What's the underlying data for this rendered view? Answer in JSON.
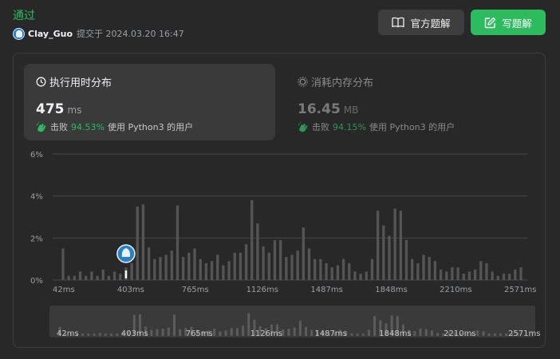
{
  "submission": {
    "status": "通过",
    "username": "Clay_Guo",
    "submitted_text": "提交于 2024.03.20 16:47"
  },
  "buttons": {
    "official_solution": "官方题解",
    "write_solution": "写题解"
  },
  "runtime": {
    "title": "执行用时分布",
    "value": "475",
    "unit": "ms",
    "beats_label": "击败",
    "beats_pct": "94.53%",
    "beats_suffix": "使用 Python3 的用户"
  },
  "memory": {
    "title": "消耗内存分布",
    "value": "16.45",
    "unit": "MB",
    "beats_label": "击败",
    "beats_pct": "94.15%",
    "beats_suffix": "使用 Python3 的用户"
  },
  "colors": {
    "accent_green": "#2cbb5d",
    "bar": "#555555",
    "bar_mini": "#5c5c5c",
    "grid": "#474747"
  },
  "chart_data": {
    "type": "bar",
    "ylabel": "",
    "xlabel": "",
    "ylim": [
      0,
      6
    ],
    "yticks": [
      "0%",
      "2%",
      "4%",
      "6%"
    ],
    "xticks": [
      "42ms",
      "403ms",
      "765ms",
      "1126ms",
      "1487ms",
      "1848ms",
      "2210ms",
      "2571ms"
    ],
    "grid": true,
    "marker_label": "user runtime position",
    "values": [
      1.5,
      0.2,
      0.2,
      0.4,
      0.2,
      0.4,
      0.2,
      0.5,
      0.2,
      0.4,
      0.3,
      0.6,
      0.8,
      3.5,
      3.6,
      1.55,
      1.0,
      1.1,
      1.2,
      1.4,
      3.55,
      1.1,
      1.3,
      1.5,
      1.0,
      0.8,
      0.9,
      1.2,
      0.7,
      0.9,
      1.3,
      1.3,
      1.7,
      3.8,
      2.7,
      1.6,
      1.3,
      1.9,
      1.9,
      1.1,
      1.2,
      1.4,
      2.5,
      1.5,
      1.0,
      1.0,
      0.8,
      0.6,
      0.7,
      1.0,
      0.8,
      0.4,
      0.3,
      0.4,
      1.0,
      3.3,
      2.6,
      2.1,
      3.4,
      3.3,
      1.9,
      1.0,
      0.8,
      1.2,
      1.1,
      0.9,
      0.5,
      0.4,
      0.6,
      0.6,
      0.3,
      0.4,
      0.5,
      0.9,
      0.8,
      0.4,
      0.2,
      0.3,
      0.3,
      0.5,
      0.6
    ],
    "marker_index": 11
  }
}
